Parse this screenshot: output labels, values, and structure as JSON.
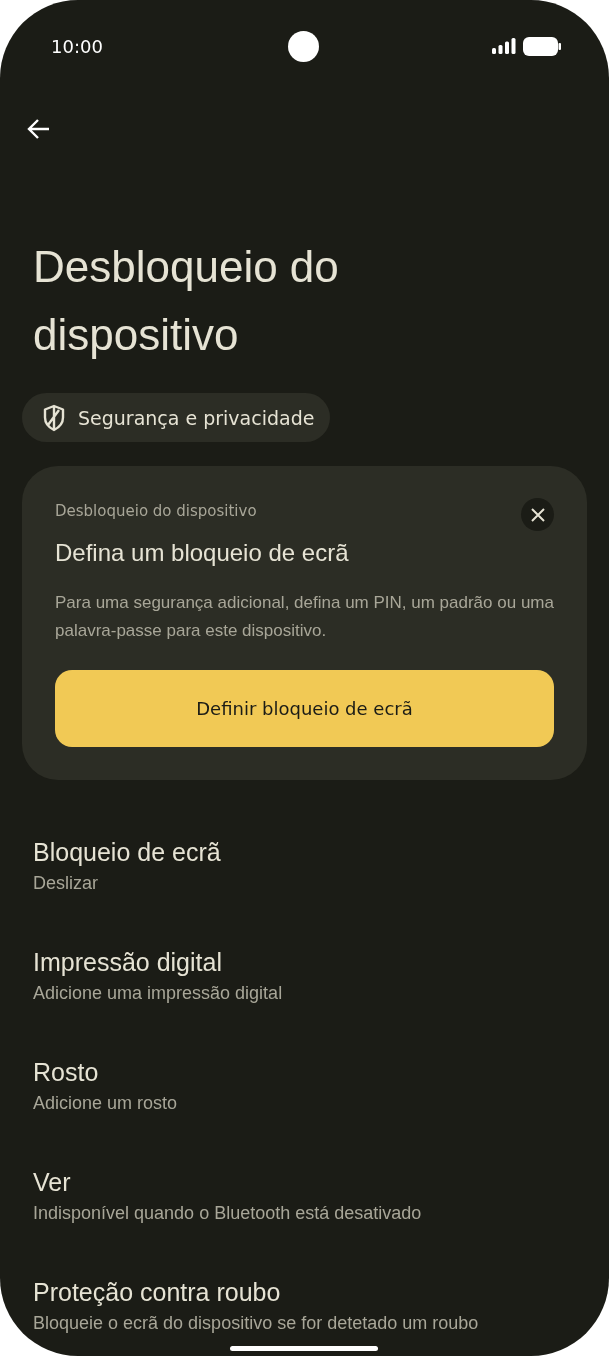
{
  "status_bar": {
    "time": "10:00"
  },
  "title": "Desbloqueio do dispositivo",
  "chip": {
    "label": "Segurança e privacidade"
  },
  "card": {
    "eyebrow": "Desbloqueio do dispositivo",
    "heading": "Defina um bloqueio de ecrã",
    "body": "Para uma segurança adicional, defina um PIN, um padrão ou uma palavra-passe para este dispositivo.",
    "button": "Definir bloqueio de ecrã"
  },
  "items": [
    {
      "title": "Bloqueio de ecrã",
      "subtitle": "Deslizar"
    },
    {
      "title": "Impressão digital",
      "subtitle": "Adicione uma impressão digital"
    },
    {
      "title": "Rosto",
      "subtitle": "Adicione um rosto"
    },
    {
      "title": "Ver",
      "subtitle": "Indisponível quando o Bluetooth está desativado"
    },
    {
      "title": "Proteção contra roubo",
      "subtitle": "Bloqueie o ecrã do dispositivo se for detetado um roubo"
    }
  ]
}
